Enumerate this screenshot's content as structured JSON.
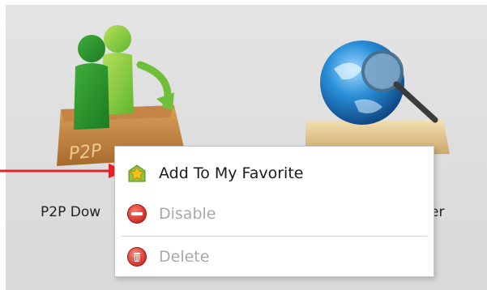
{
  "desktop": {
    "icons": [
      {
        "label": "P2P Dow",
        "icon": "p2p-downloader-icon"
      },
      {
        "label": "er",
        "icon": "network-browser-icon"
      }
    ]
  },
  "context_menu": {
    "items": [
      {
        "label": "Add To My Favorite",
        "icon": "star-favorite-icon",
        "enabled": true
      },
      {
        "label": "Disable",
        "icon": "disable-icon",
        "enabled": false
      },
      {
        "label": "Delete",
        "icon": "trash-icon",
        "enabled": false
      }
    ]
  },
  "colors": {
    "pointer_arrow": "#e2232a",
    "disabled_text": "#a9a9a9",
    "disable_icon_red": "#d9302c"
  }
}
